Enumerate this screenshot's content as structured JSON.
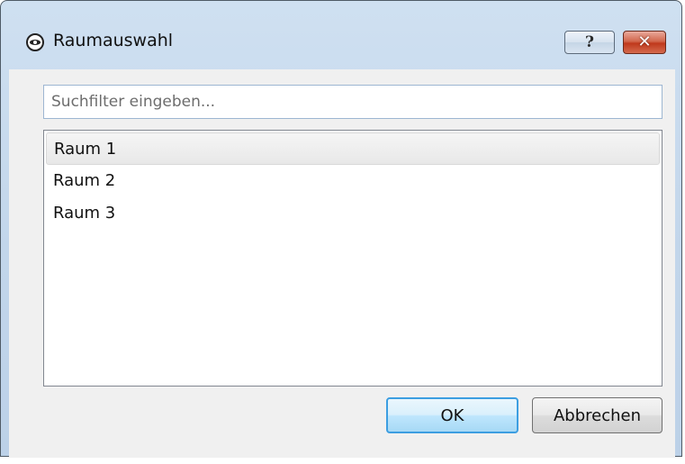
{
  "window": {
    "title": "Raumauswahl",
    "icon": "eye-icon",
    "help_label": "?",
    "close_label": "✕"
  },
  "search": {
    "value": "",
    "placeholder": "Suchfilter eingeben..."
  },
  "list": {
    "items": [
      {
        "label": "Raum 1",
        "selected": true
      },
      {
        "label": "Raum 2",
        "selected": false
      },
      {
        "label": "Raum 3",
        "selected": false
      }
    ]
  },
  "buttons": {
    "ok_label": "OK",
    "cancel_label": "Abbrechen"
  },
  "colors": {
    "frame": "#c2d6eb",
    "close_button": "#c0391c",
    "default_button_border": "#3c9ee1"
  }
}
